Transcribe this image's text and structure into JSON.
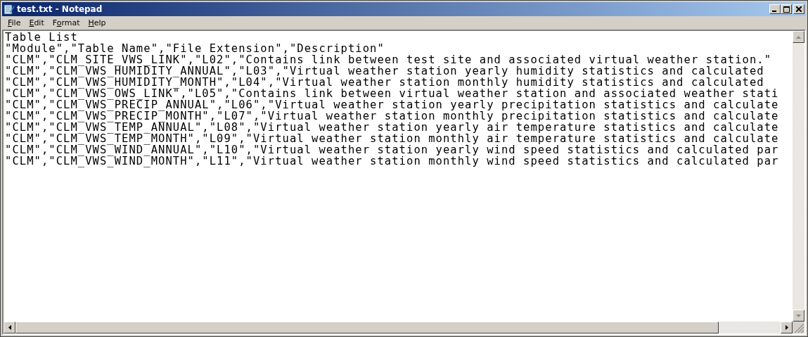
{
  "window": {
    "title": "test.txt - Notepad"
  },
  "menu": [
    {
      "mnemonic": "F",
      "rest": "ile"
    },
    {
      "mnemonic": "E",
      "rest": "dit"
    },
    {
      "mnemonic": "o",
      "before": "F",
      "rest": "rmat"
    },
    {
      "mnemonic": "H",
      "rest": "elp"
    }
  ],
  "lines": [
    "Table List",
    "\"Module\",\"Table Name\",\"File Extension\",\"Description\"",
    "\"CLM\",\"CLM_SITE_VWS_LINK\",\"L02\",\"Contains link between test site and associated virtual weather station.\"",
    "\"CLM\",\"CLM_VWS_HUMIDITY_ANNUAL\",\"L03\",\"Virtual weather station yearly humidity statistics and calculated",
    "\"CLM\",\"CLM_VWS_HUMIDITY_MONTH\",\"L04\",\"Virtual weather station monthly humidity statistics and calculated",
    "\"CLM\",\"CLM_VWS_OWS_LINK\",\"L05\",\"Contains link between virtual weather station and associated weather stati",
    "\"CLM\",\"CLM_VWS_PRECIP_ANNUAL\",\"L06\",\"Virtual weather station yearly precipitation statistics and calculate",
    "\"CLM\",\"CLM_VWS_PRECIP_MONTH\",\"L07\",\"Virtual weather station monthly precipitation statistics and calculate",
    "\"CLM\",\"CLM_VWS_TEMP_ANNUAL\",\"L08\",\"Virtual weather station yearly air temperature statistics and calculate",
    "\"CLM\",\"CLM_VWS_TEMP_MONTH\",\"L09\",\"Virtual weather station monthly air temperature statistics and calculate",
    "\"CLM\",\"CLM_VWS_WIND_ANNUAL\",\"L10\",\"Virtual weather station yearly wind speed statistics and calculated par",
    "\"CLM\",\"CLM_VWS_WIND_MONTH\",\"L11\",\"Virtual weather station monthly wind speed statistics and calculated par"
  ]
}
